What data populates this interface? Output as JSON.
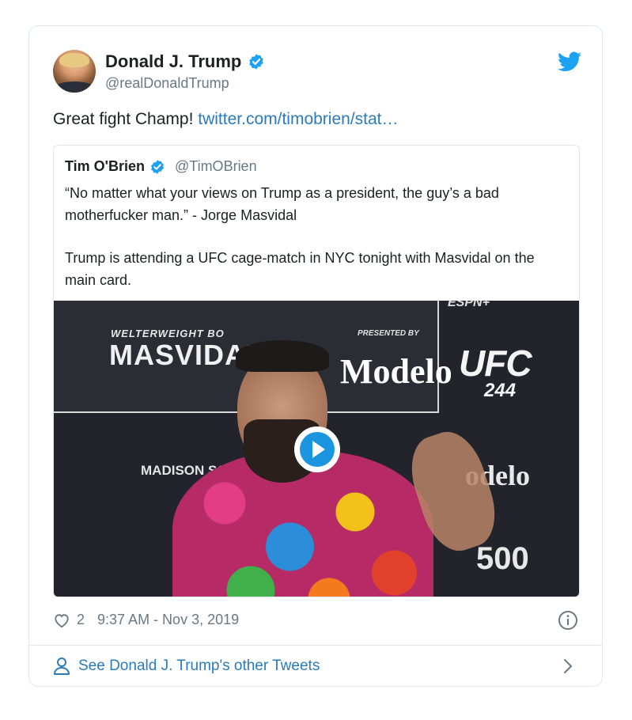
{
  "tweet": {
    "author": {
      "name": "Donald J. Trump",
      "handle": "@realDonaldTrump"
    },
    "text": "Great fight Champ!",
    "link_text": "twitter.com/timobrien/stat…",
    "likes": "2",
    "timestamp": "9:37 AM - Nov 3, 2019",
    "footer_label": "See Donald J. Trump's other Tweets"
  },
  "quoted": {
    "name": "Tim O'Brien",
    "handle": "@TimOBrien",
    "paragraph1": "“No matter what your views on Trump as a president, the guy’s a bad motherfucker man.” - Jorge Masvidal",
    "paragraph2": "Trump is attending a UFC cage-match in NYC tonight with Masvidal on the main card."
  },
  "video": {
    "backdrop": {
      "welterweight": "WELTERWEIGHT BO",
      "masvidal": "MASVIDAL",
      "presented_by": "PRESENTED BY",
      "modelo": "Modelo",
      "ufc": "UFC",
      "ufc_number": "244",
      "msg": "MADISON SQUAR",
      "modelo_right": "odelo",
      "number_500": "500",
      "ufc_top": "ESPN+"
    }
  },
  "colors": {
    "link": "#2b7bb9",
    "verified": "#1da1f2",
    "twitter_bird": "#1da1f2",
    "play_button": "#1b95e0",
    "muted_text": "#697882"
  },
  "icons": {
    "verified": "verified-badge-icon",
    "bird": "twitter-bird-icon",
    "play": "play-icon",
    "heart": "heart-icon",
    "info": "info-icon",
    "person": "person-icon",
    "chevron": "chevron-right-icon"
  }
}
